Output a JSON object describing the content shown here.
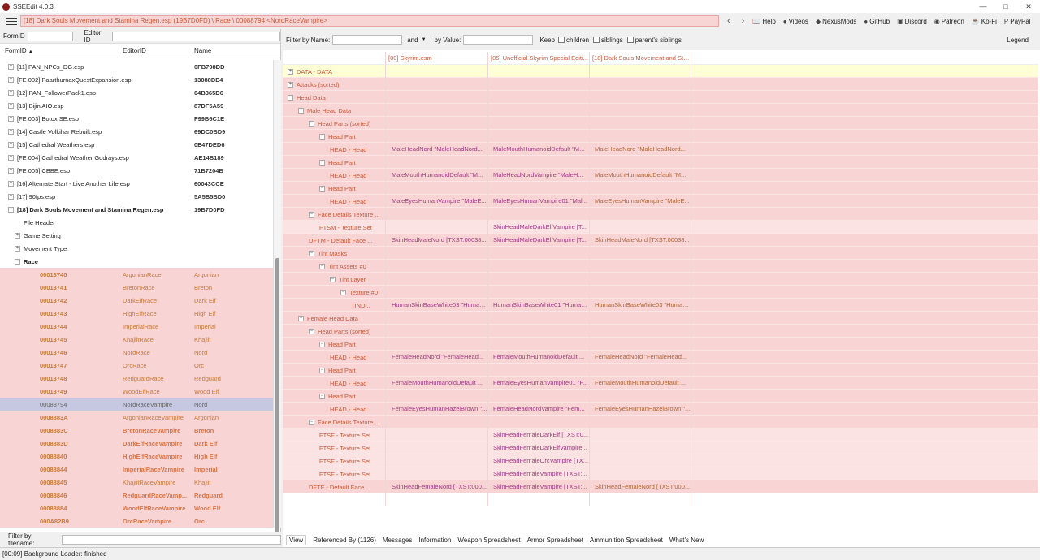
{
  "window": {
    "title": "SSEEdit 4.0.3",
    "minimize": "—",
    "maximize": "□",
    "close": "✕"
  },
  "toolbar": {
    "path": "[18] Dark Souls Movement and Stamina Regen.esp (19B7D0FD) \\ Race \\ 00088794 <NordRaceVampire>",
    "back": "‹",
    "forward": "›",
    "links": [
      {
        "label": "Help",
        "icon": "book-icon",
        "glyph": "📖"
      },
      {
        "label": "Videos",
        "icon": "video-icon",
        "glyph": "●"
      },
      {
        "label": "NexusMods",
        "icon": "nexus-icon",
        "glyph": "◆"
      },
      {
        "label": "GitHub",
        "icon": "github-icon",
        "glyph": "●"
      },
      {
        "label": "Discord",
        "icon": "discord-icon",
        "glyph": "▣"
      },
      {
        "label": "Patreon",
        "icon": "patreon-icon",
        "glyph": "◉"
      },
      {
        "label": "Ko-Fi",
        "icon": "kofi-icon",
        "glyph": "☕"
      },
      {
        "label": "PayPal",
        "icon": "paypal-icon",
        "glyph": "P"
      }
    ]
  },
  "left": {
    "formid_label": "FormID",
    "editorid_label": "Editor ID",
    "columns": [
      "FormID",
      "EditorID",
      "Name"
    ],
    "sort_glyph": "▲",
    "filter_label": "Filter by filename:",
    "tree": [
      {
        "indent": 1,
        "exp": "+",
        "text": "[11] PAN_NPCs_DG.esp",
        "name": "0FB798DD"
      },
      {
        "indent": 1,
        "exp": "+",
        "text": "[FE 002] PaarthurnaxQuestExpansion.esp",
        "name": "13088DE4"
      },
      {
        "indent": 1,
        "exp": "+",
        "text": "[12] PAN_FollowerPack1.esp",
        "name": "04B365D6"
      },
      {
        "indent": 1,
        "exp": "+",
        "text": "[13] Bijin AIO.esp",
        "name": "87DF5A59"
      },
      {
        "indent": 1,
        "exp": "+",
        "text": "[FE 003] Botox SE.esp",
        "name": "F99B6C1E"
      },
      {
        "indent": 1,
        "exp": "+",
        "text": "[14] Castle Volkihar Rebuilt.esp",
        "name": "69DC0BD9"
      },
      {
        "indent": 1,
        "exp": "+",
        "text": "[15] Cathedral Weathers.esp",
        "name": "0E47DED6"
      },
      {
        "indent": 1,
        "exp": "+",
        "text": "[FE 004] Cathedral Weather Godrays.esp",
        "name": "AE14B189"
      },
      {
        "indent": 1,
        "exp": "+",
        "text": "[FE 005] CBBE.esp",
        "name": "71B7204B"
      },
      {
        "indent": 1,
        "exp": "+",
        "text": "[16] Alternate Start - Live Another Life.esp",
        "name": "60043CCE"
      },
      {
        "indent": 1,
        "exp": "+",
        "text": "[17] 90fps.esp",
        "name": "5A5B5BD0"
      },
      {
        "indent": 1,
        "exp": "−",
        "text": "[18] Dark Souls Movement and Stamina Regen.esp",
        "name": "19B7D0FD",
        "bold": true
      },
      {
        "indent": 2,
        "exp": "",
        "text": "File Header",
        "name": ""
      },
      {
        "indent": 2,
        "exp": "+",
        "text": "Game Setting",
        "name": ""
      },
      {
        "indent": 2,
        "exp": "+",
        "text": "Movement Type",
        "name": ""
      },
      {
        "indent": 2,
        "exp": "−",
        "text": "Race",
        "name": "",
        "bold": true
      }
    ],
    "records": [
      {
        "fid": "00013740",
        "edid": "ArgonianRace",
        "name": "Argonian"
      },
      {
        "fid": "00013741",
        "edid": "BretonRace",
        "name": "Breton"
      },
      {
        "fid": "00013742",
        "edid": "DarkElfRace",
        "name": "Dark Elf"
      },
      {
        "fid": "00013743",
        "edid": "HighElfRace",
        "name": "High Elf"
      },
      {
        "fid": "00013744",
        "edid": "ImperialRace",
        "name": "Imperial"
      },
      {
        "fid": "00013745",
        "edid": "KhajiitRace",
        "name": "Khajiit"
      },
      {
        "fid": "00013746",
        "edid": "NordRace",
        "name": "Nord"
      },
      {
        "fid": "00013747",
        "edid": "OrcRace",
        "name": "Orc"
      },
      {
        "fid": "00013748",
        "edid": "RedguardRace",
        "name": "Redguard"
      },
      {
        "fid": "00013749",
        "edid": "WoodElfRace",
        "name": "Wood Elf"
      },
      {
        "fid": "00088794",
        "edid": "NordRaceVampire",
        "name": "Nord",
        "selected": true
      },
      {
        "fid": "0008883A",
        "edid": "ArgonianRaceVampire",
        "name": "Argonian"
      },
      {
        "fid": "0008883C",
        "edid": "BretonRaceVampire",
        "name": "Breton",
        "bold": true
      },
      {
        "fid": "0008883D",
        "edid": "DarkElfRaceVampire",
        "name": "Dark Elf",
        "bold": true
      },
      {
        "fid": "00088840",
        "edid": "HighElfRaceVampire",
        "name": "High Elf",
        "bold": true
      },
      {
        "fid": "00088844",
        "edid": "ImperialRaceVampire",
        "name": "Imperial",
        "bold": true
      },
      {
        "fid": "00088845",
        "edid": "KhajiitRaceVampire",
        "name": "Khajiit"
      },
      {
        "fid": "00088846",
        "edid": "RedguardRaceVamp...",
        "name": "Redguard",
        "bold": true
      },
      {
        "fid": "00088884",
        "edid": "WoodElfRaceVampire",
        "name": "Wood Elf",
        "bold": true
      },
      {
        "fid": "000A82B9",
        "edid": "OrcRaceVampire",
        "name": "Orc",
        "bold": true
      }
    ]
  },
  "right": {
    "filter_name_label": "Filter by Name:",
    "and_label": "and",
    "by_value_label": "by Value:",
    "keep_label": "Keep",
    "children_label": "children",
    "siblings_label": "siblings",
    "parents_label": "parent's siblings",
    "legend_label": "Legend",
    "columns": [
      "[00] Skyrim.esm",
      "[05] Unofficial Skyrim Special Editi...",
      "[18] Dark Souls Movement and Sta..."
    ],
    "rows": [
      {
        "lvl": 0,
        "exp": "+",
        "label": "DATA - DATA",
        "v1": "",
        "v2": "",
        "v3": "",
        "bg": "yellow"
      },
      {
        "lvl": 0,
        "exp": "+",
        "label": "Attacks (sorted)",
        "v1": "",
        "v2": "",
        "v3": "",
        "bg": "pink"
      },
      {
        "lvl": 0,
        "exp": "−",
        "label": "Head Data",
        "v1": "",
        "v2": "",
        "v3": "",
        "bg": "pink"
      },
      {
        "lvl": 1,
        "exp": "−",
        "label": "Male Head Data",
        "v1": "",
        "v2": "",
        "v3": "",
        "bg": "pink"
      },
      {
        "lvl": 2,
        "exp": "−",
        "label": "Head Parts (sorted)",
        "v1": "",
        "v2": "",
        "v3": "",
        "bg": "pink"
      },
      {
        "lvl": 3,
        "exp": "−",
        "label": "Head Part",
        "v1": "",
        "v2": "",
        "v3": "",
        "bg": "pink"
      },
      {
        "lvl": 4,
        "exp": "",
        "label": "HEAD - Head",
        "v1": "MaleHeadNord \"MaleHeadNord...",
        "v2": "MaleMouthHumanoidDefault \"M...",
        "v3": "MaleHeadNord \"MaleHeadNord...",
        "bg": "pink"
      },
      {
        "lvl": 3,
        "exp": "−",
        "label": "Head Part",
        "v1": "",
        "v2": "",
        "v3": "",
        "bg": "pink"
      },
      {
        "lvl": 4,
        "exp": "",
        "label": "HEAD - Head",
        "v1": "MaleMouthHumanoidDefault \"M...",
        "v2": "MaleHeadNordVampire \"MaleH...",
        "v3": "MaleMouthHumanoidDefault \"M...",
        "bg": "pink"
      },
      {
        "lvl": 3,
        "exp": "−",
        "label": "Head Part",
        "v1": "",
        "v2": "",
        "v3": "",
        "bg": "pink"
      },
      {
        "lvl": 4,
        "exp": "",
        "label": "HEAD - Head",
        "v1": "MaleEyesHumanVampire \"MaleE...",
        "v2": "MaleEyesHumanVampire01 \"Mal...",
        "v3": "MaleEyesHumanVampire \"MaleE...",
        "bg": "pink"
      },
      {
        "lvl": 2,
        "exp": "−",
        "label": "Face Details Texture ...",
        "v1": "",
        "v2": "",
        "v3": "",
        "bg": "pink"
      },
      {
        "lvl": 3,
        "exp": "",
        "label": "FTSM - Texture Set",
        "v1": "",
        "v2": "SkinHeadMaleDarkElfVampire [T...",
        "v3": "",
        "bg": "light"
      },
      {
        "lvl": 2,
        "exp": "",
        "label": "DFTM - Default Face ...",
        "v1": "SkinHeadMaleNord [TXST:00038...",
        "v2": "SkinHeadMaleDarkElfVampire [T...",
        "v3": "SkinHeadMaleNord [TXST:00038...",
        "bg": "pink"
      },
      {
        "lvl": 2,
        "exp": "−",
        "label": "Tint Masks",
        "v1": "",
        "v2": "",
        "v3": "",
        "bg": "pink"
      },
      {
        "lvl": 3,
        "exp": "−",
        "label": "Tint Assets #0",
        "v1": "",
        "v2": "",
        "v3": "",
        "bg": "pink"
      },
      {
        "lvl": 4,
        "exp": "−",
        "label": "Tint Layer",
        "v1": "",
        "v2": "",
        "v3": "",
        "bg": "pink"
      },
      {
        "lvl": 5,
        "exp": "−",
        "label": "Texture #0",
        "v1": "",
        "v2": "",
        "v3": "",
        "bg": "pink"
      },
      {
        "lvl": 6,
        "exp": "",
        "label": "TIND...",
        "v1": "HumanSkinBaseWhite03 \"Human...",
        "v2": "HumanSkinBaseWhite01 \"Human...",
        "v3": "HumanSkinBaseWhite03 \"Human...",
        "bg": "pink"
      },
      {
        "lvl": 1,
        "exp": "−",
        "label": "Female Head Data",
        "v1": "",
        "v2": "",
        "v3": "",
        "bg": "pink"
      },
      {
        "lvl": 2,
        "exp": "−",
        "label": "Head Parts (sorted)",
        "v1": "",
        "v2": "",
        "v3": "",
        "bg": "pink"
      },
      {
        "lvl": 3,
        "exp": "−",
        "label": "Head Part",
        "v1": "",
        "v2": "",
        "v3": "",
        "bg": "pink"
      },
      {
        "lvl": 4,
        "exp": "",
        "label": "HEAD - Head",
        "v1": "FemaleHeadNord \"FemaleHead...",
        "v2": "FemaleMouthHumanoidDefault ...",
        "v3": "FemaleHeadNord \"FemaleHead...",
        "bg": "pink"
      },
      {
        "lvl": 3,
        "exp": "−",
        "label": "Head Part",
        "v1": "",
        "v2": "",
        "v3": "",
        "bg": "pink"
      },
      {
        "lvl": 4,
        "exp": "",
        "label": "HEAD - Head",
        "v1": "FemaleMouthHumanoidDefault ...",
        "v2": "FemaleEyesHumanVampire01 \"F...",
        "v3": "FemaleMouthHumanoidDefault ...",
        "bg": "pink"
      },
      {
        "lvl": 3,
        "exp": "−",
        "label": "Head Part",
        "v1": "",
        "v2": "",
        "v3": "",
        "bg": "pink"
      },
      {
        "lvl": 4,
        "exp": "",
        "label": "HEAD - Head",
        "v1": "FemaleEyesHumanHazelBrown \"...",
        "v2": "FemaleHeadNordVampire \"Fem...",
        "v3": "FemaleEyesHumanHazelBrown \"...",
        "bg": "pink"
      },
      {
        "lvl": 2,
        "exp": "−",
        "label": "Face Details Texture ...",
        "v1": "",
        "v2": "",
        "v3": "",
        "bg": "pink"
      },
      {
        "lvl": 3,
        "exp": "",
        "label": "FTSF - Texture Set",
        "v1": "",
        "v2": "SkinHeadFemaleDarkElf [TXST:0...",
        "v3": "",
        "bg": "light"
      },
      {
        "lvl": 3,
        "exp": "",
        "label": "FTSF - Texture Set",
        "v1": "",
        "v2": "SkinHeadFemaleDarkElfVampire...",
        "v3": "",
        "bg": "light"
      },
      {
        "lvl": 3,
        "exp": "",
        "label": "FTSF - Texture Set",
        "v1": "",
        "v2": "SkinHeadFemaleOrcVampire [TX...",
        "v3": "",
        "bg": "light"
      },
      {
        "lvl": 3,
        "exp": "",
        "label": "FTSF - Texture Set",
        "v1": "",
        "v2": "SkinHeadFemaleVampire [TXST:...",
        "v3": "",
        "bg": "light"
      },
      {
        "lvl": 2,
        "exp": "",
        "label": "DFTF - Default Face ...",
        "v1": "SkinHeadFemaleNord [TXST:000...",
        "v2": "SkinHeadFemaleVampire [TXST:...",
        "v3": "SkinHeadFemaleNord [TXST:000...",
        "bg": "pink"
      }
    ],
    "tabs": [
      "View",
      "Referenced By (1126)",
      "Messages",
      "Information",
      "Weapon Spreadsheet",
      "Armor Spreadsheet",
      "Ammunition Spreadsheet",
      "What's New"
    ]
  },
  "status": "[00:09] Background Loader: finished",
  "colors": {
    "pink": "#f8d4d4",
    "light": "#fbe3e3",
    "yellow": "#ffffd6",
    "selected": "#c5c8e0",
    "accent": "#c85a3c"
  }
}
